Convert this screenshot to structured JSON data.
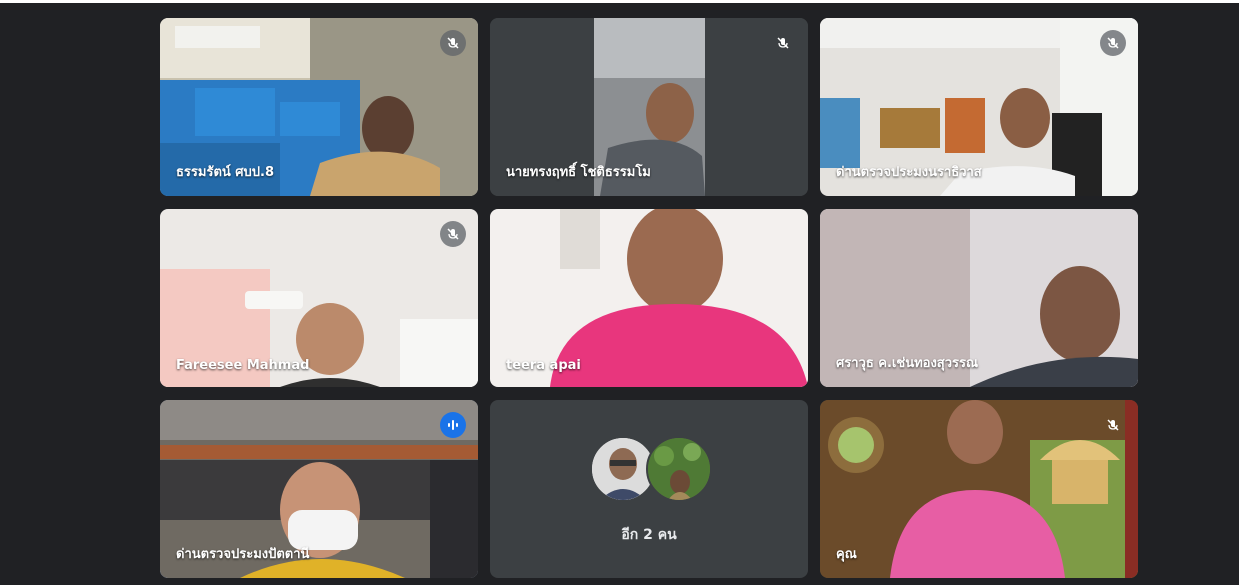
{
  "participants": [
    {
      "name": "ธรรมรัตน์ ศบป.8",
      "muted": true
    },
    {
      "name": "นายทรงฤทธิ์ โชติธรรมโม",
      "muted": true
    },
    {
      "name": "ด่านตรวจประมงนราธิวาส",
      "muted": true
    },
    {
      "name": "Fareesee Mahmad",
      "muted": true
    },
    {
      "name": "teera apai",
      "muted": false
    },
    {
      "name": "ศราวุธ ค.เช่นทองสุวรรณ",
      "muted": false
    },
    {
      "name": "ด่านตรวจประมงปัตตานี",
      "speaking": true
    },
    {
      "name": "คุณ",
      "muted": true
    }
  ],
  "others_tile": {
    "label": "อีก 2 คน"
  },
  "colors": {
    "background": "#202124",
    "tile": "#3c4043",
    "speaking": "#1a73e8",
    "active_border": "#8ab4f8"
  }
}
